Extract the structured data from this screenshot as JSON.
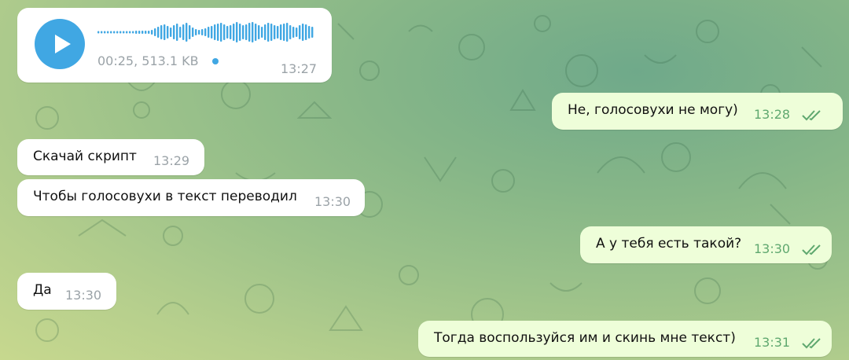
{
  "voice_message": {
    "meta": "00:25, 513.1 KB",
    "time": "13:27"
  },
  "messages": [
    {
      "direction": "outgoing",
      "text": "Не, голосовухи не могу)",
      "time": "13:28"
    },
    {
      "direction": "incoming",
      "text": "Скачай скрипт",
      "time": "13:29"
    },
    {
      "direction": "incoming",
      "text": "Чтобы голосовухи в текст переводил",
      "time": "13:30"
    },
    {
      "direction": "outgoing",
      "text": "А у тебя есть такой?",
      "time": "13:30"
    },
    {
      "direction": "incoming",
      "text": "Да",
      "time": "13:30"
    },
    {
      "direction": "outgoing",
      "text": "Тогда воспользуйся им и скинь мне текст)",
      "time": "13:31"
    }
  ],
  "colors": {
    "accent": "#40a7e3",
    "outgoing_bubble": "#eefed9",
    "incoming_bubble": "#ffffff",
    "tick": "#5fa86f"
  },
  "icons": {
    "play": "play-icon",
    "read_receipt": "double-check-icon"
  }
}
